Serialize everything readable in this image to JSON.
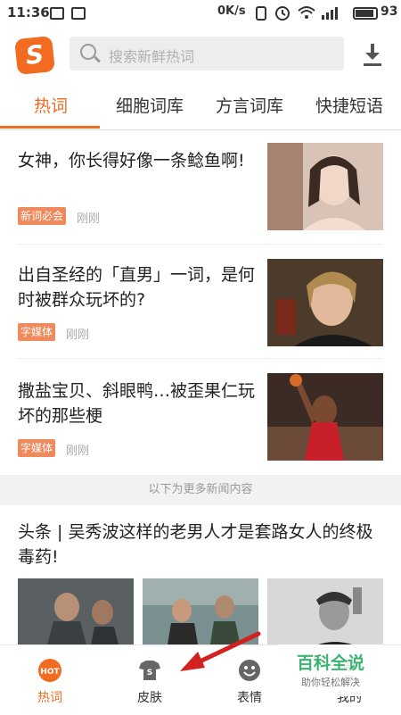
{
  "status": {
    "time": "11:36",
    "net": "0K/s",
    "battery": "93"
  },
  "search": {
    "placeholder": "搜索新鲜热词"
  },
  "tabs": [
    {
      "label": "热词"
    },
    {
      "label": "细胞词库"
    },
    {
      "label": "方言词库"
    },
    {
      "label": "快捷短语"
    }
  ],
  "articles": [
    {
      "title": "女神，你长得好像一条鲶鱼啊!",
      "tag": "新词必会",
      "time": "刚刚"
    },
    {
      "title": "出自圣经的「直男」一词，是何时被群众玩坏的?",
      "tag": "字媒体",
      "time": "刚刚"
    },
    {
      "title": "撒盐宝贝、斜眼鸭…被歪果仁玩坏的那些梗",
      "tag": "字媒体",
      "time": "刚刚"
    }
  ],
  "more_label": "以下为更多新闻内容",
  "feature": {
    "title": "头条 | 吴秀波这样的老男人才是套路女人的终极毒药!"
  },
  "nav": [
    {
      "label": "热词"
    },
    {
      "label": "皮肤"
    },
    {
      "label": "表情"
    },
    {
      "label": "我的"
    }
  ],
  "watermark": {
    "line1": "百科全说",
    "line2": "助你轻松解决"
  },
  "colors": {
    "accent": "#f26b21",
    "tag": "#f08a5d",
    "arrow": "#d32020"
  }
}
